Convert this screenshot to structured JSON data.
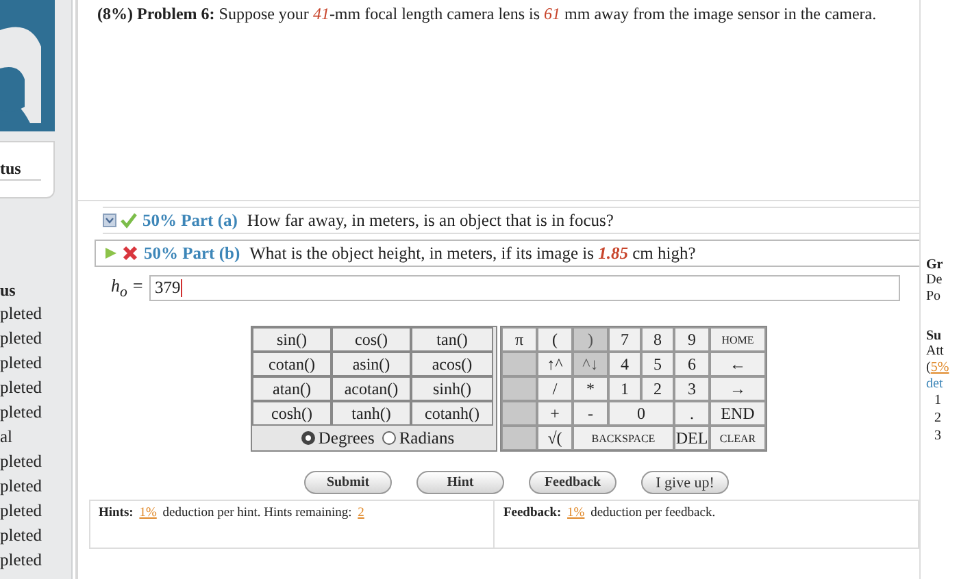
{
  "sidebar": {
    "heading_1": "tus",
    "heading_2": "us",
    "items": [
      "pleted",
      "pleted",
      "pleted",
      "pleted",
      "pleted",
      "al",
      "pleted",
      "pleted",
      "pleted",
      "pleted",
      "pleted"
    ]
  },
  "problem": {
    "text": "**(8%) Problem 6:** Suppose your *41*-mm focal length camera lens is *61* mm away from the image sensor in the camera."
  },
  "parts": [
    {
      "label": "50% Part (a)",
      "question": "How far away, in meters, is an object that is in focus?",
      "kind": "correct",
      "expanded": false
    },
    {
      "label": "50% Part (b)",
      "question": "What is the object height, in meters, if its image is *1.85* cm high?",
      "kind": "incorrect",
      "expanded": true
    }
  ],
  "answer": {
    "label": "h$_{o}$ =",
    "value": "379"
  },
  "keypad": {
    "functions": [
      [
        "sin()",
        "cos()",
        "tan()"
      ],
      [
        "cotan()",
        "asin()",
        "acos()"
      ],
      [
        "atan()",
        "acotan()",
        "sinh()"
      ],
      [
        "cosh()",
        "tanh()",
        "cotanh()"
      ]
    ],
    "angle_modes": [
      {
        "label": "Degrees",
        "selected": true
      },
      {
        "label": "Radians",
        "selected": false
      }
    ],
    "keys": [
      {
        "label": "π",
        "disabled": false,
        "kind": "single"
      },
      {
        "label": "(",
        "disabled": false,
        "kind": "single"
      },
      {
        "label": ")",
        "disabled": true,
        "kind": "single"
      },
      {
        "label": "7",
        "disabled": false,
        "kind": "single"
      },
      {
        "label": "8",
        "disabled": false,
        "kind": "single"
      },
      {
        "label": "9",
        "disabled": false,
        "kind": "single"
      },
      {
        "label": "HOME",
        "disabled": false,
        "kind": "single"
      },
      {
        "disabled": true,
        "kind": "single"
      },
      {
        "label": "↑^",
        "disabled": false,
        "kind": "single"
      },
      {
        "label": "^↓",
        "disabled": true,
        "kind": "single"
      },
      {
        "label": "4",
        "disabled": false,
        "kind": "single"
      },
      {
        "label": "5",
        "disabled": false,
        "kind": "single"
      },
      {
        "label": "6",
        "disabled": false,
        "kind": "single"
      },
      {
        "label": "←",
        "disabled": false,
        "kind": "single"
      },
      {
        "disabled": true,
        "kind": "single"
      },
      {
        "label": "/",
        "disabled": false,
        "kind": "single"
      },
      {
        "label": "*",
        "disabled": false,
        "kind": "single"
      },
      {
        "label": "1",
        "disabled": false,
        "kind": "single"
      },
      {
        "label": "2",
        "disabled": false,
        "kind": "single"
      },
      {
        "label": "3",
        "disabled": false,
        "kind": "single"
      },
      {
        "label": "→",
        "disabled": false,
        "kind": "single"
      },
      {
        "disabled": true,
        "kind": "single"
      },
      {
        "label": "+",
        "disabled": false,
        "kind": "single"
      },
      {
        "label": "-",
        "disabled": false,
        "kind": "single"
      },
      {
        "label": "0",
        "disabled": false,
        "kind": "double"
      },
      {
        "label": ".",
        "disabled": false,
        "kind": "single"
      },
      {
        "label": "END",
        "disabled": false,
        "kind": "single"
      },
      {
        "disabled": true,
        "kind": "single"
      },
      {
        "label": "√(",
        "disabled": false,
        "kind": "single"
      },
      {
        "label": "BACKSPACE",
        "disabled": false,
        "kind": "triple"
      },
      {
        "label": "DEL",
        "disabled": false,
        "kind": "single"
      },
      {
        "label": "CLEAR",
        "disabled": false,
        "kind": "single"
      }
    ]
  },
  "buttons": [
    "Submit",
    "Hint",
    "Feedback",
    "I give up!"
  ],
  "hints": {
    "label": "Hints:",
    "deduction": "1%",
    "text": "deduction per hint. Hints remaining:",
    "remaining": "2"
  },
  "feedback": {
    "label": "Feedback:",
    "deduction": "1%",
    "text": "deduction per feedback."
  },
  "side_panel": [
    {
      "kind": "heading",
      "text": "Gr"
    },
    {
      "kind": "plain",
      "text": "De"
    },
    {
      "kind": "plain",
      "text": "Po"
    },
    {
      "kind": "heading",
      "text": "Su"
    },
    {
      "kind": "plain",
      "text": "Att"
    },
    {
      "kind": "link_line",
      "text": "(",
      "link": "5%"
    },
    {
      "kind": "link",
      "text": "det"
    },
    {
      "kind": "number",
      "text": "1"
    },
    {
      "kind": "number",
      "text": "2"
    },
    {
      "kind": "number",
      "text": "3"
    }
  ]
}
